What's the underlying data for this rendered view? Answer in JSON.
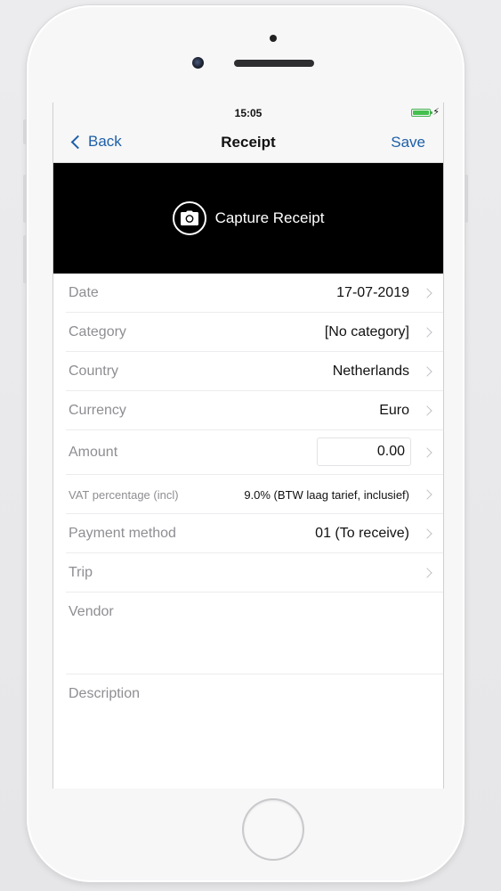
{
  "status_bar": {
    "time": "15:05",
    "charging_symbol": "⚡"
  },
  "nav": {
    "back_label": "Back",
    "title": "Receipt",
    "save_label": "Save"
  },
  "capture": {
    "label": "Capture Receipt",
    "icon": "camera-icon"
  },
  "form": {
    "date": {
      "label": "Date",
      "value": "17-07-2019"
    },
    "category": {
      "label": "Category",
      "value": "[No category]"
    },
    "country": {
      "label": "Country",
      "value": "Netherlands"
    },
    "currency": {
      "label": "Currency",
      "value": "Euro"
    },
    "amount": {
      "label": "Amount",
      "value": "0.00"
    },
    "vat": {
      "label": "VAT percentage (incl)",
      "value": "9.0% (BTW laag tarief, inclusief)"
    },
    "payment_method": {
      "label": "Payment method",
      "value": "01 (To receive)"
    },
    "trip": {
      "label": "Trip",
      "value": ""
    },
    "vendor": {
      "label": "Vendor"
    },
    "description": {
      "label": "Description"
    }
  },
  "colors": {
    "accent": "#1d5fa8",
    "label_gray": "#8e8e93",
    "battery_green": "#45c04f",
    "capture_bg": "#000000"
  }
}
